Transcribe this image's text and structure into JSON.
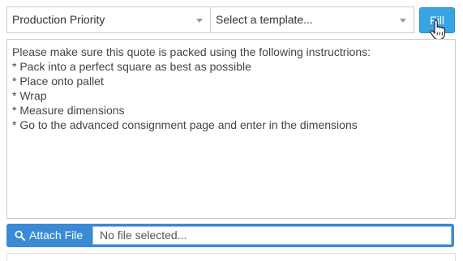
{
  "priority_select": {
    "value": "Production Priority"
  },
  "template_select": {
    "placeholder": "Select a template..."
  },
  "fill_button": {
    "label": "Fill",
    "color": "#3aa3e3"
  },
  "instructions": {
    "text": "Please make sure this quote is packed using the following instructrions:\n* Pack into a perfect square as best as possible\n* Place onto pallet\n* Wrap\n* Measure dimensions\n* Go to the advanced consignment page and enter in the dimensions"
  },
  "attachment": {
    "button_label": "Attach File",
    "button_icon": "search-icon",
    "button_color": "#3a8ad6",
    "file_status": "No file selected..."
  }
}
